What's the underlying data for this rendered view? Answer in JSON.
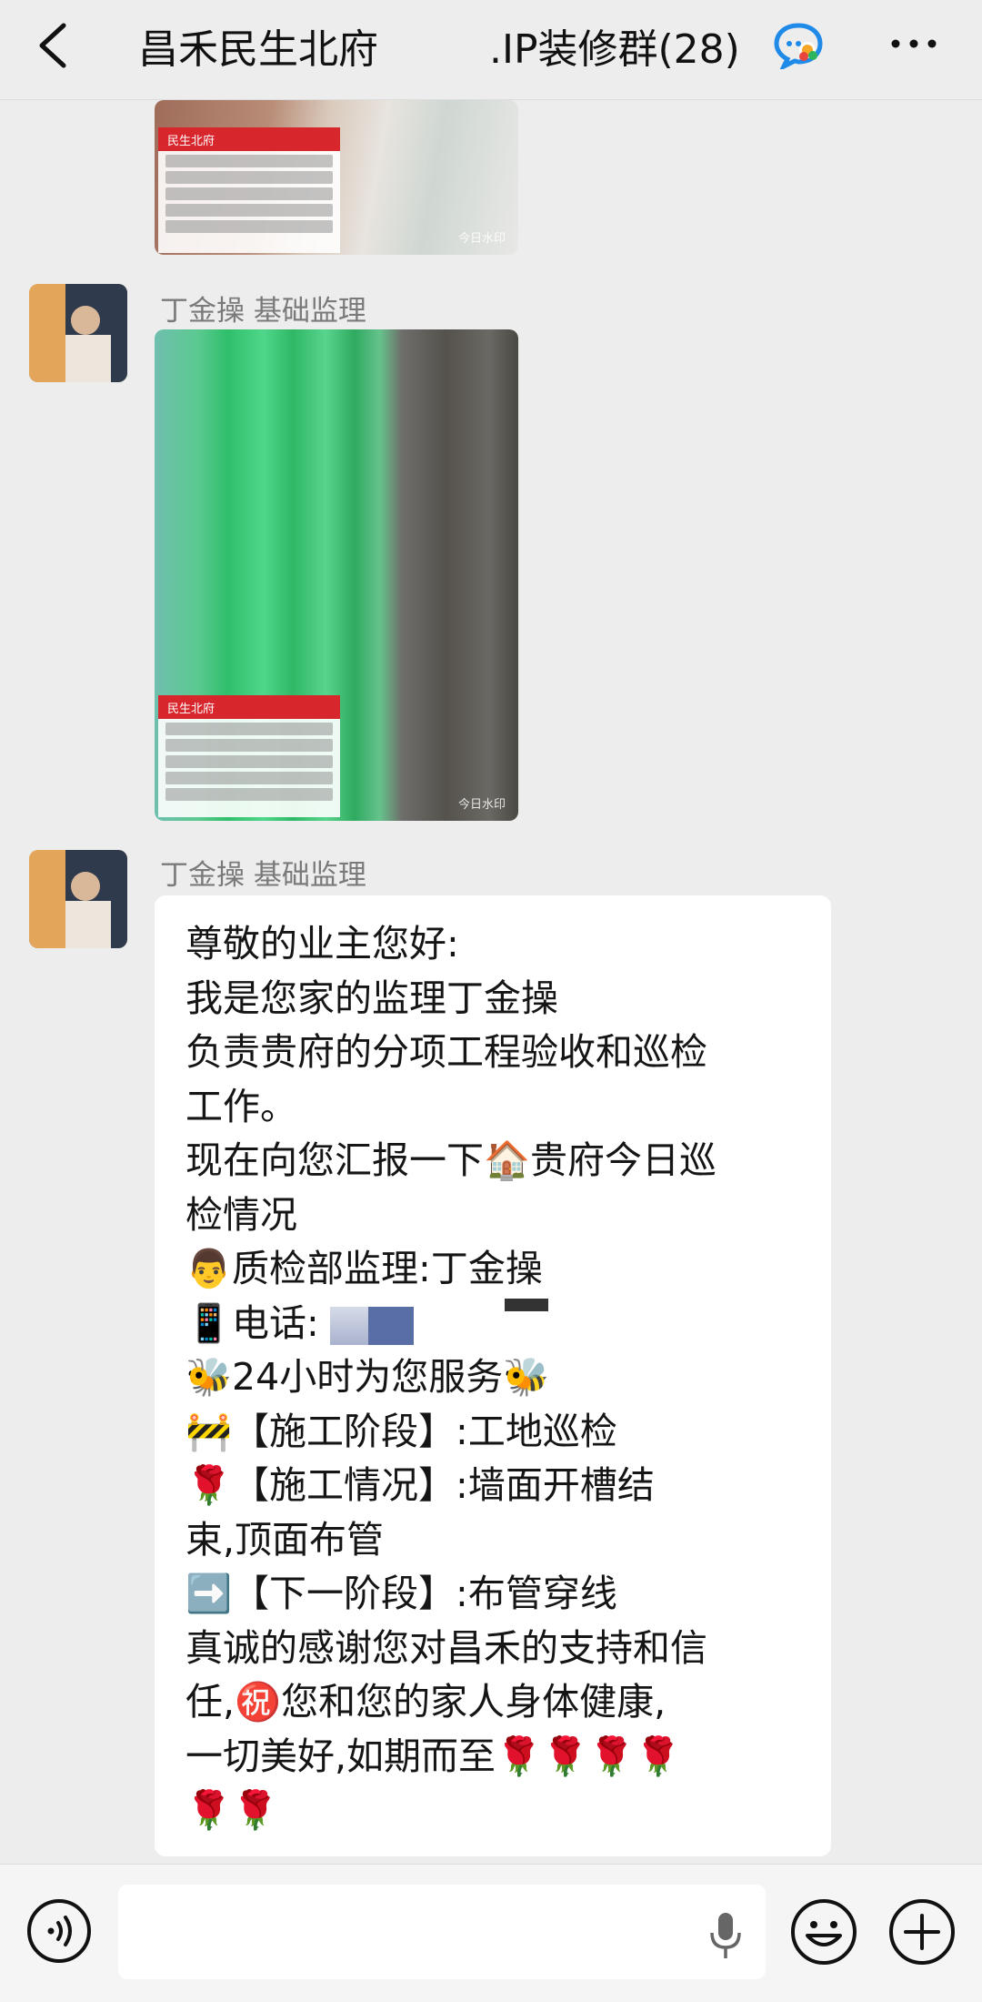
{
  "header": {
    "title_start": "昌禾民生北府",
    "title_end": ".IP装修群(28)",
    "back_icon": "chevron-left-icon",
    "badge_icon": "group-chat-badge-icon",
    "more_icon": "more-dots-icon"
  },
  "messages": [
    {
      "type": "image",
      "label_header": "民生北府",
      "watermark": "今日水印"
    },
    {
      "type": "image",
      "sender": "丁金操 基础监理",
      "label_header": "民生北府",
      "watermark": "今日水印"
    },
    {
      "type": "text",
      "sender": "丁金操 基础监理",
      "lines": [
        "尊敬的业主您好:",
        "我是您家的监理丁金操",
        "负责贵府的分项工程验收和巡检",
        "工作。",
        "现在向您汇报一下🏠贵府今日巡",
        "检情况",
        "👨质检部监理:丁金操",
        "📱电话:",
        "🐝24小时为您服务🐝",
        "🚧【施工阶段】:工地巡检",
        "🌹【施工情况】:墙面开槽结",
        "束,顶面布管",
        "➡️【下一阶段】:布管穿线",
        "真诚的感谢您对昌禾的支持和信",
        "任,㊗️您和您的家人身体健康,",
        "一切美好,如期而至🌹🌹🌹🌹",
        "🌹🌹"
      ]
    }
  ],
  "bottom_bar": {
    "voice_icon": "voice-input-icon",
    "mic_icon": "microphone-icon",
    "emoji_icon": "emoji-icon",
    "plus_icon": "plus-icon",
    "input_value": ""
  },
  "colors": {
    "background": "#ededed",
    "bubble": "#ffffff",
    "sender_text": "#7a7a7a",
    "label_red": "#d7262c"
  }
}
